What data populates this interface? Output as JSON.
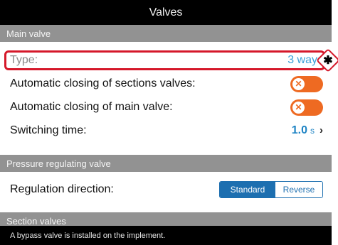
{
  "header": {
    "title": "Valves"
  },
  "sections": {
    "main_valve": "Main valve",
    "pressure": "Pressure regulating valve",
    "section_valves": "Section valves"
  },
  "rows": {
    "type": {
      "label": "Type:",
      "value": "3 ways"
    },
    "auto_sections": {
      "label": "Automatic closing of sections valves:",
      "state": "off"
    },
    "auto_main": {
      "label": "Automatic closing of main valve:",
      "state": "off"
    },
    "switching": {
      "label": "Switching time:",
      "value": "1.0",
      "unit": "s"
    },
    "regulation": {
      "label": "Regulation direction:",
      "options": [
        "Standard",
        "Reverse"
      ],
      "selected": "Standard"
    }
  },
  "toggle_glyph": "✕",
  "chevron": "›",
  "badge": "✱",
  "footer": {
    "text": "A bypass valve is installed on the implement."
  },
  "colors": {
    "accent_orange": "#ee6a22",
    "accent_blue": "#1d6fb0",
    "highlight_red": "#d5182a"
  }
}
